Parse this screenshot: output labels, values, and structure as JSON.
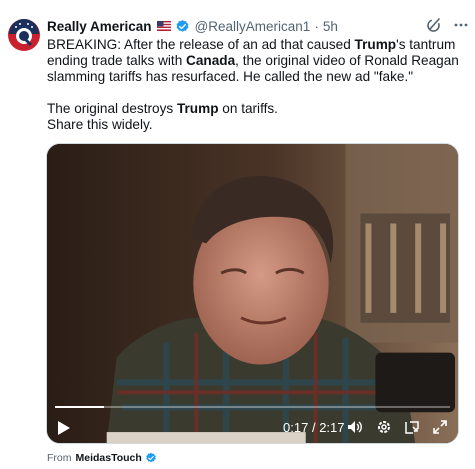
{
  "author": {
    "name": "Really American",
    "handle": "@ReallyAmerican1",
    "separator": "·",
    "time": "5h",
    "flag_icon": "us-flag-icon",
    "verified_icon": "verified-badge-icon",
    "verified_color": "#1d9bf0"
  },
  "tweet": {
    "p1_a": "BREAKING: After the release of an ad that caused ",
    "p1_b": "Trump",
    "p1_c": "'s tantrum ending trade talks with ",
    "p1_d": "Canada",
    "p1_e": ", the original video of Ronald Reagan slamming tariffs has resurfaced. He called the new ad \"fake.\"",
    "p2_a": "The original destroys ",
    "p2_b": "Trump",
    "p2_c": " on tariffs.",
    "p3": "Share this widely."
  },
  "video": {
    "current_time": "0:17",
    "time_separator": "/",
    "duration": "2:17",
    "progress_fraction": 0.124,
    "icons": [
      "play-icon",
      "volume-icon",
      "settings-gear-icon",
      "pip-icon",
      "fullscreen-icon"
    ]
  },
  "source": {
    "label": "From",
    "name": "MeidasTouch"
  },
  "colors": {
    "text": "#0f1419",
    "secondary": "#536471",
    "accent": "#1d9bf0"
  }
}
